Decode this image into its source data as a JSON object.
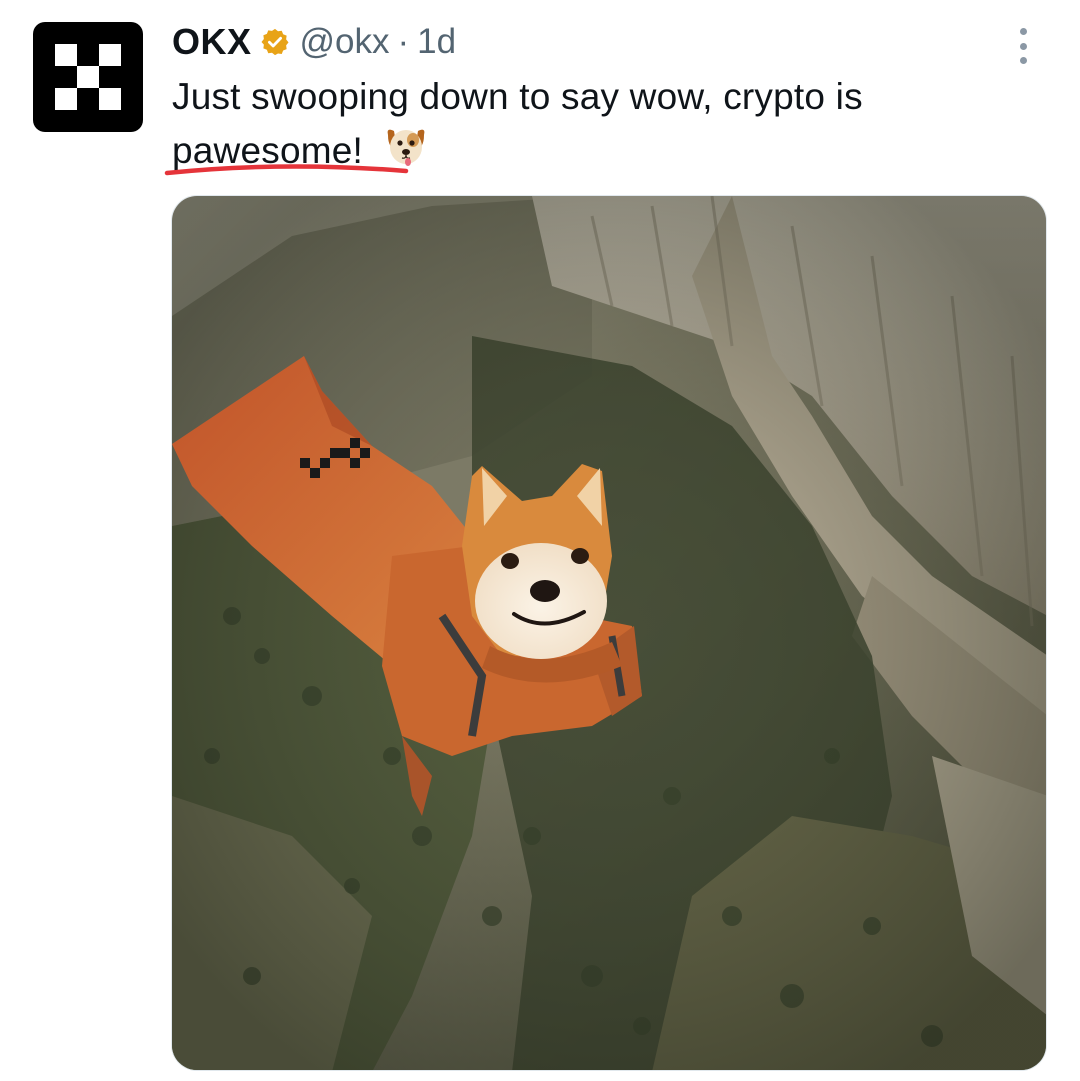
{
  "post": {
    "display_name": "OKX",
    "handle": "@okx",
    "separator": "·",
    "time": "1d",
    "text_line1": "Just swooping down to say wow, crypto is",
    "text_line2": "pawesome!",
    "emoji": "dog-face-emoji"
  },
  "icons": {
    "verified": "verified-badge-icon",
    "more": "more-options-icon",
    "avatar": "okx-logo"
  },
  "colors": {
    "text": "#0f1419",
    "secondary": "#536471",
    "verified_badge": "#e8a317",
    "underline": "#e5343a"
  }
}
